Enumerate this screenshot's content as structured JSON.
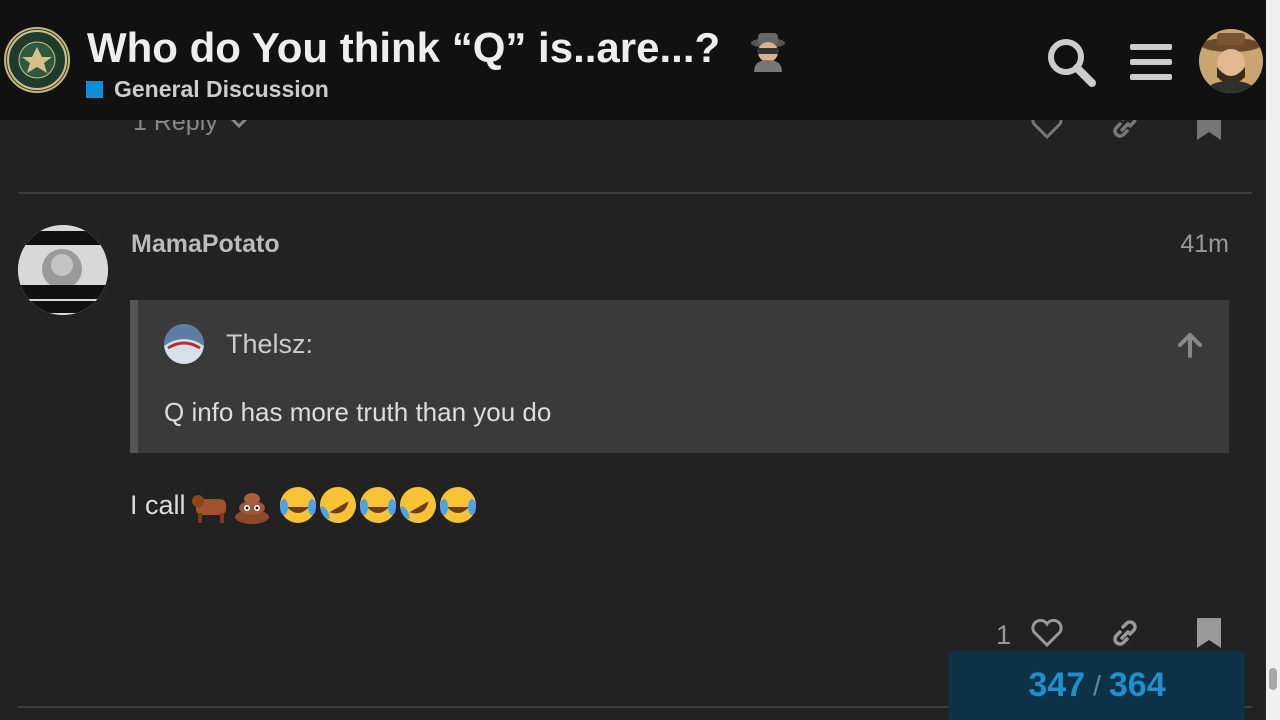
{
  "header": {
    "topic_title": "Who do You think “Q” is..are...?",
    "category_name": "General Discussion",
    "category_color": "#0e8ed8"
  },
  "previous_post": {
    "reply_label": "1 Reply"
  },
  "post": {
    "username": "MamaPotato",
    "age": "41m",
    "quote": {
      "username": "Thelsz:",
      "text": "Q info has more truth than you do"
    },
    "body_text": "I call",
    "emojis": [
      "ox-emoji",
      "poop-emoji",
      "joy-emoji",
      "rofl-emoji",
      "joy-emoji",
      "rofl-emoji",
      "joy-emoji"
    ],
    "like_count": "1"
  },
  "progress": {
    "current": "347",
    "separator": "/",
    "total": "364"
  }
}
